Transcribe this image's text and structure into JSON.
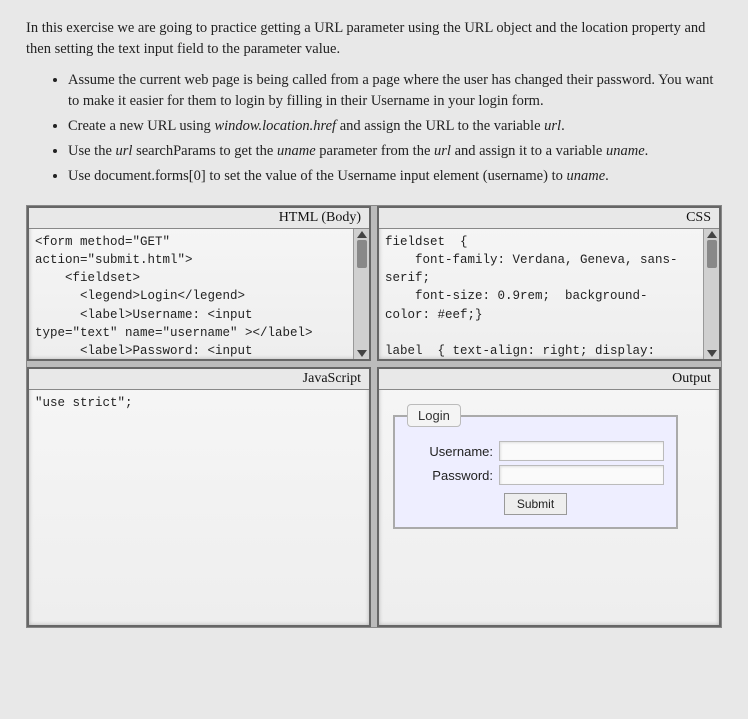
{
  "intro": "In this exercise we are going to practice getting a URL parameter using the URL object and the location property and then setting the text input field to the parameter value.",
  "bullets": [
    {
      "pre": "Assume the current web page is being called from a page where the user has changed their password. You want to make it easier for them to login by filling in their Username in your login form."
    },
    {
      "pre": "Create a new URL using ",
      "it1": "window.location.href",
      "mid": " and assign the URL to the variable ",
      "it2": "url",
      "post": "."
    },
    {
      "pre": "Use the ",
      "it1": "url",
      "mid": " searchParams to get the ",
      "it2": "uname",
      "mid2": " parameter from the ",
      "it3": "url",
      "mid3": " and assign it to a variable ",
      "it4": "uname",
      "post": "."
    },
    {
      "pre": "Use document.forms[0] to set the value of the Username input element (username) to ",
      "it1": "uname",
      "post": "."
    }
  ],
  "panes": {
    "html": {
      "title": "HTML (Body)",
      "code": "<form method=\"GET\"\naction=\"submit.html\">\n    <fieldset>\n      <legend>Login</legend>\n      <label>Username: <input\ntype=\"text\" name=\"username\" ></label>\n      <label>Password: <input"
    },
    "css": {
      "title": "CSS",
      "code": "fieldset  {\n    font-family: Verdana, Geneva, sans-\nserif;\n    font-size: 0.9rem;  background-\ncolor: #eef;}\n\nlabel  { text-align: right; display:"
    },
    "js": {
      "title": "JavaScript",
      "code": "\"use strict\";"
    },
    "output": {
      "title": "Output",
      "legend": "Login",
      "username_label": "Username:",
      "password_label": "Password:",
      "submit_label": "Submit"
    }
  }
}
